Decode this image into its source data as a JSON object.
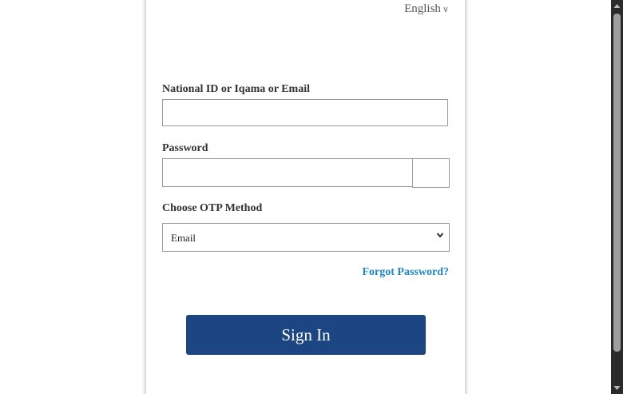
{
  "header": {
    "language_label": "English",
    "language_chevron": "chevron-down-icon"
  },
  "form": {
    "id_label": "National ID or Iqama or Email",
    "id_value": "",
    "password_label": "Password",
    "password_value": "",
    "otp_label": "Choose OTP Method",
    "otp_selected": "Email",
    "forgot_label": "Forgot Password?",
    "signin_label": "Sign In"
  },
  "colors": {
    "primary_button": "#1c4681",
    "link": "#1f86c1",
    "scrollbar_track": "#2b2b2b",
    "scrollbar_thumb": "#9e9e9e"
  }
}
